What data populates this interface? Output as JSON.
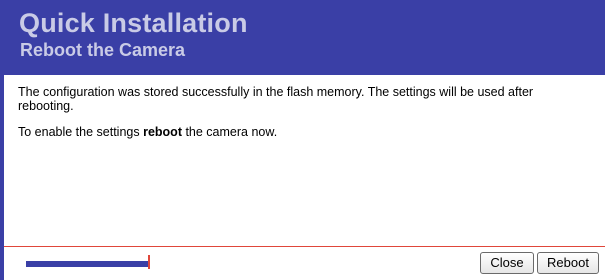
{
  "header": {
    "title": "Quick Installation",
    "subtitle": "Reboot the Camera"
  },
  "content": {
    "paragraph1": "The configuration was stored successfully in the flash memory. The settings will be used after rebooting.",
    "paragraph2_prefix": "To enable the settings ",
    "paragraph2_bold": "reboot",
    "paragraph2_suffix": " the camera now."
  },
  "progress": {
    "fill_fraction": 1.0
  },
  "buttons": {
    "close_label": "Close",
    "reboot_label": "Reboot"
  },
  "colors": {
    "header_bg": "#3a3fa6",
    "header_text": "#c9cbe6",
    "accent_red": "#e0463a"
  }
}
